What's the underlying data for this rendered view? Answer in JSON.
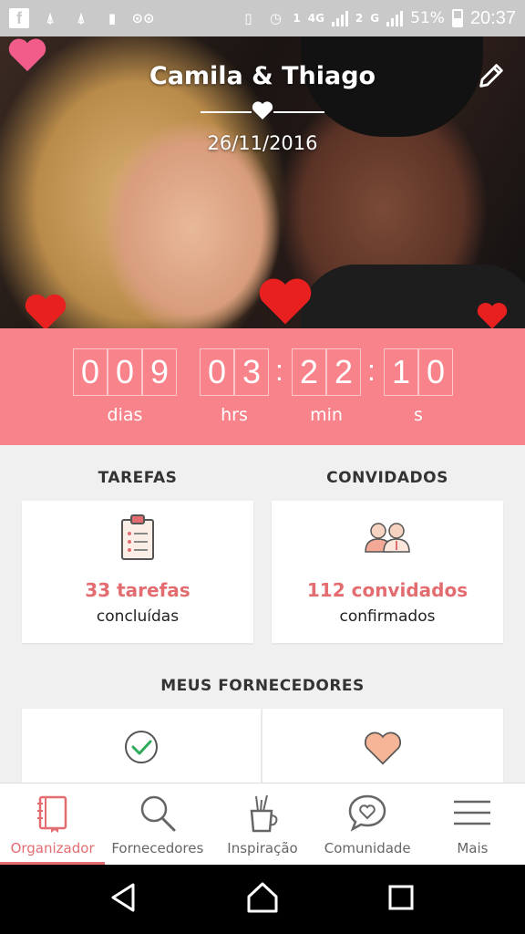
{
  "status_bar": {
    "battery": "51%",
    "time": "20:37",
    "network": "4G",
    "sim1": "1",
    "sim2": "2",
    "net2": "G"
  },
  "hero": {
    "names": "Camila & Thiago",
    "date": "26/11/2016"
  },
  "countdown": {
    "days": [
      "0",
      "0",
      "9"
    ],
    "hours": [
      "0",
      "3"
    ],
    "minutes": [
      "2",
      "2"
    ],
    "seconds": [
      "1",
      "0"
    ],
    "labels": {
      "days": "dias",
      "hours": "hrs",
      "minutes": "min",
      "seconds": "s"
    }
  },
  "tasks": {
    "title": "TAREFAS",
    "count": "33 tarefas",
    "status": "concluídas"
  },
  "guests": {
    "title": "CONVIDADOS",
    "count": "112 convidados",
    "status": "confirmados"
  },
  "vendors": {
    "title": "MEUS FORNECEDORES"
  },
  "bottom_nav": [
    {
      "label": "Organizador",
      "icon": "notebook-icon",
      "active": true
    },
    {
      "label": "Fornecedores",
      "icon": "search-icon",
      "active": false
    },
    {
      "label": "Inspiração",
      "icon": "pencil-cup-icon",
      "active": false
    },
    {
      "label": "Comunidade",
      "icon": "chat-heart-icon",
      "active": false
    },
    {
      "label": "Mais",
      "icon": "menu-icon",
      "active": false
    }
  ],
  "colors": {
    "accent": "#f8838a",
    "accent_text": "#e36c70"
  }
}
